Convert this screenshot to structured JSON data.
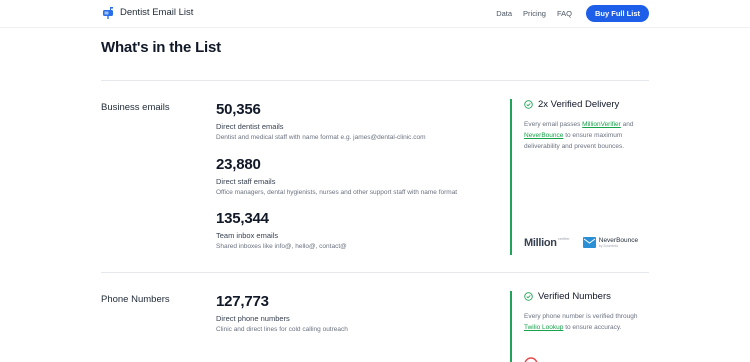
{
  "header": {
    "brand_name": "Dentist Email List",
    "nav": [
      "Data",
      "Pricing",
      "FAQ"
    ],
    "cta_label": "Buy Full List"
  },
  "page_title": "What's in the List",
  "sections": [
    {
      "label": "Business emails",
      "stats": [
        {
          "value": "50,356",
          "title": "Direct dentist emails",
          "desc": "Dentist and medical staff with name format e.g. james@dental-clinic.com"
        },
        {
          "value": "23,880",
          "title": "Direct staff emails",
          "desc": "Office managers, dental hygienists, nurses and other support staff with name format"
        },
        {
          "value": "135,344",
          "title": "Team inbox emails",
          "desc": "Shared inboxes like info@, hello@, contact@"
        }
      ],
      "verify": {
        "title": "2x Verified Delivery",
        "text_1": "Every email passes ",
        "link_1": "MillionVerifier",
        "text_2": " and ",
        "link_2": "NeverBounce",
        "text_3": " to ensure maximum deliverability and prevent bounces.",
        "logo_1_text": "Million",
        "logo_1_sup": "verifier",
        "logo_2_text": "NeverBounce",
        "logo_2_sub": "by ZoomInfo"
      }
    },
    {
      "label": "Phone Numbers",
      "stats": [
        {
          "value": "127,773",
          "title": "Direct phone numbers",
          "desc": "Clinic and direct lines for cold calling outreach"
        }
      ],
      "verify": {
        "title": "Verified Numbers",
        "text_1": "Every phone number is verified through ",
        "link_1": "Twilio Lookup",
        "text_2": " to ensure accuracy."
      }
    }
  ],
  "colors": {
    "accent": "#1d5fe8",
    "verified_green": "#22a35a"
  }
}
